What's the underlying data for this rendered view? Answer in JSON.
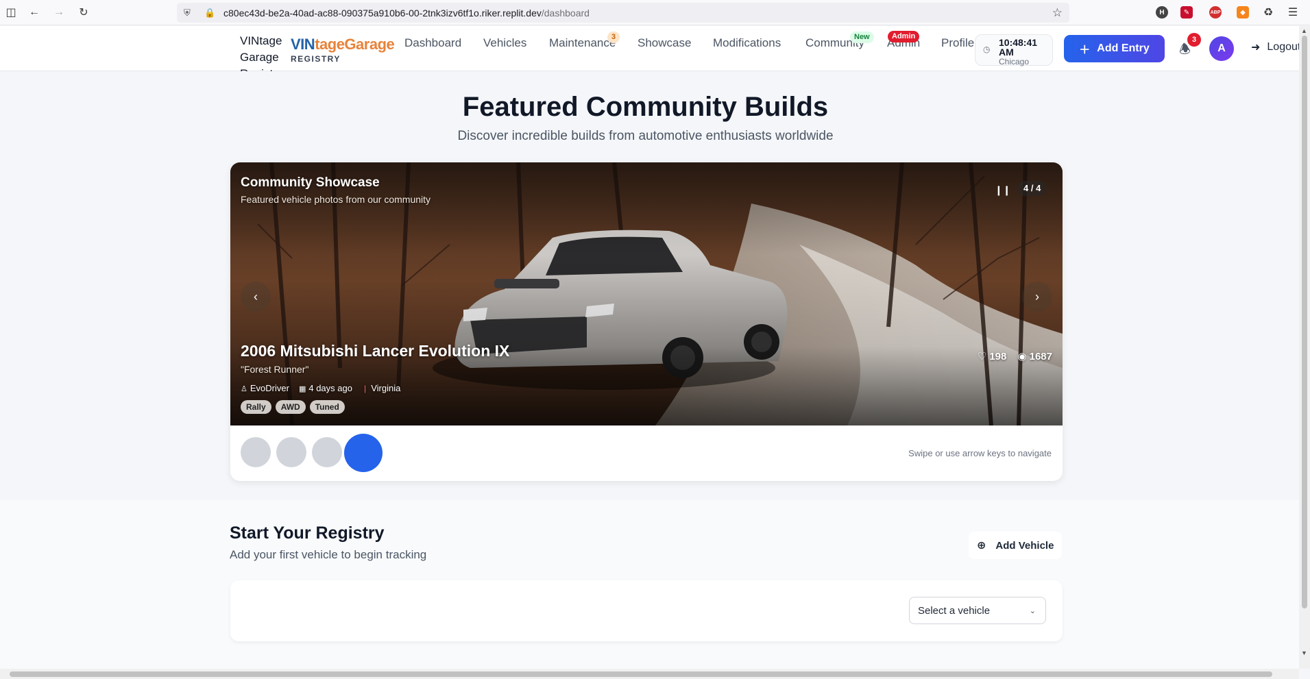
{
  "browser": {
    "url_host": "c80ec43d-be2a-40ad-ac88-090375a910b6-00-2tnk3izv6tf1o.riker.replit.dev",
    "url_path": "/dashboard"
  },
  "header": {
    "logo_alt": "VINtage Garage Registry Logo",
    "brand_vin": "VIN",
    "brand_rest": "tageGarage",
    "brand_sub": "REGISTRY",
    "nav": [
      {
        "label": "Dashboard"
      },
      {
        "label": "Vehicles"
      },
      {
        "label": "Maintenance",
        "badge": "3"
      },
      {
        "label": "Showcase"
      },
      {
        "label": "Modifications"
      },
      {
        "label": "Community",
        "badge": "New"
      },
      {
        "label": "Admin",
        "badge": "Admin"
      },
      {
        "label": "Profile"
      }
    ],
    "clock": {
      "time": "10:48:41 AM",
      "city": "Chicago"
    },
    "add_entry_label": "Add Entry",
    "notification_count": "3",
    "avatar_initial": "A",
    "logout_label": "Logout"
  },
  "featured": {
    "title": "Featured Community Builds",
    "subtitle": "Discover incredible builds from automotive enthusiasts worldwide",
    "showcase_title": "Community Showcase",
    "showcase_subtitle": "Featured vehicle photos from our community",
    "counter": "4 / 4",
    "slide": {
      "title": "2006 Mitsubishi Lancer Evolution IX",
      "nickname": "\"Forest Runner\"",
      "owner": "EvoDriver",
      "posted": "4 days ago",
      "location": "Virginia",
      "tags": [
        "Rally",
        "AWD",
        "Tuned"
      ],
      "likes": "198",
      "views": "1687"
    },
    "slide_count": 4,
    "active_slide": 4,
    "swipe_hint": "Swipe or use arrow keys to navigate"
  },
  "registry": {
    "title": "Start Your Registry",
    "subtitle": "Add your first vehicle to begin tracking",
    "add_vehicle_label": "Add Vehicle",
    "select_placeholder": "Select a vehicle"
  },
  "colors": {
    "primary": "#2563eb",
    "brand_blue": "#2563a8",
    "brand_orange": "#e8833a",
    "danger": "#e11d2e"
  }
}
